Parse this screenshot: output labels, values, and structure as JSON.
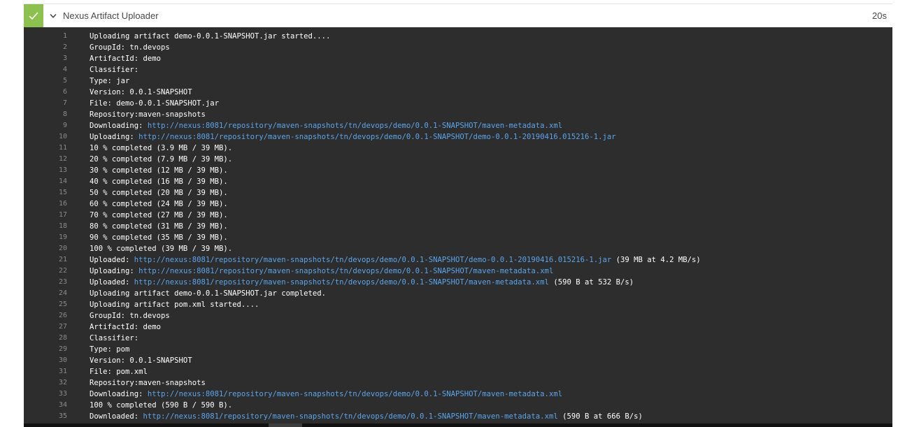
{
  "step": {
    "title": "Nexus Artifact Uploader",
    "duration": "20s",
    "status": "success",
    "status_icon": "checkmark-icon",
    "toggle_icon": "chevron-down-icon"
  },
  "colors": {
    "success": "#8cc04f",
    "log_background": "#2d2d2d",
    "link": "#5aa5ec",
    "line_number": "#8a8a8a",
    "text": "#ffffff"
  },
  "log": {
    "lines": [
      {
        "n": "1",
        "pre": "Uploading artifact demo-0.0.1-SNAPSHOT.jar started....",
        "link": "",
        "post": ""
      },
      {
        "n": "2",
        "pre": "GroupId: tn.devops",
        "link": "",
        "post": ""
      },
      {
        "n": "3",
        "pre": "ArtifactId: demo",
        "link": "",
        "post": ""
      },
      {
        "n": "4",
        "pre": "Classifier:",
        "link": "",
        "post": ""
      },
      {
        "n": "5",
        "pre": "Type: jar",
        "link": "",
        "post": ""
      },
      {
        "n": "6",
        "pre": "Version: 0.0.1-SNAPSHOT",
        "link": "",
        "post": ""
      },
      {
        "n": "7",
        "pre": "File: demo-0.0.1-SNAPSHOT.jar",
        "link": "",
        "post": ""
      },
      {
        "n": "8",
        "pre": "Repository:maven-snapshots",
        "link": "",
        "post": ""
      },
      {
        "n": "9",
        "pre": "Downloading: ",
        "link": "http://nexus:8081/repository/maven-snapshots/tn/devops/demo/0.0.1-SNAPSHOT/maven-metadata.xml",
        "post": ""
      },
      {
        "n": "10",
        "pre": "Uploading: ",
        "link": "http://nexus:8081/repository/maven-snapshots/tn/devops/demo/0.0.1-SNAPSHOT/demo-0.0.1-20190416.015216-1.jar",
        "post": ""
      },
      {
        "n": "11",
        "pre": "10 % completed (3.9 MB / 39 MB).",
        "link": "",
        "post": ""
      },
      {
        "n": "12",
        "pre": "20 % completed (7.9 MB / 39 MB).",
        "link": "",
        "post": ""
      },
      {
        "n": "13",
        "pre": "30 % completed (12 MB / 39 MB).",
        "link": "",
        "post": ""
      },
      {
        "n": "14",
        "pre": "40 % completed (16 MB / 39 MB).",
        "link": "",
        "post": ""
      },
      {
        "n": "15",
        "pre": "50 % completed (20 MB / 39 MB).",
        "link": "",
        "post": ""
      },
      {
        "n": "16",
        "pre": "60 % completed (24 MB / 39 MB).",
        "link": "",
        "post": ""
      },
      {
        "n": "17",
        "pre": "70 % completed (27 MB / 39 MB).",
        "link": "",
        "post": ""
      },
      {
        "n": "18",
        "pre": "80 % completed (31 MB / 39 MB).",
        "link": "",
        "post": ""
      },
      {
        "n": "19",
        "pre": "90 % completed (35 MB / 39 MB).",
        "link": "",
        "post": ""
      },
      {
        "n": "20",
        "pre": "100 % completed (39 MB / 39 MB).",
        "link": "",
        "post": ""
      },
      {
        "n": "21",
        "pre": "Uploaded: ",
        "link": "http://nexus:8081/repository/maven-snapshots/tn/devops/demo/0.0.1-SNAPSHOT/demo-0.0.1-20190416.015216-1.jar",
        "post": " (39 MB at 4.2 MB/s)"
      },
      {
        "n": "22",
        "pre": "Uploading: ",
        "link": "http://nexus:8081/repository/maven-snapshots/tn/devops/demo/0.0.1-SNAPSHOT/maven-metadata.xml",
        "post": ""
      },
      {
        "n": "23",
        "pre": "Uploaded: ",
        "link": "http://nexus:8081/repository/maven-snapshots/tn/devops/demo/0.0.1-SNAPSHOT/maven-metadata.xml",
        "post": " (590 B at 532 B/s)"
      },
      {
        "n": "24",
        "pre": "Uploading artifact demo-0.0.1-SNAPSHOT.jar completed.",
        "link": "",
        "post": ""
      },
      {
        "n": "25",
        "pre": "Uploading artifact pom.xml started....",
        "link": "",
        "post": ""
      },
      {
        "n": "26",
        "pre": "GroupId: tn.devops",
        "link": "",
        "post": ""
      },
      {
        "n": "27",
        "pre": "ArtifactId: demo",
        "link": "",
        "post": ""
      },
      {
        "n": "28",
        "pre": "Classifier:",
        "link": "",
        "post": ""
      },
      {
        "n": "29",
        "pre": "Type: pom",
        "link": "",
        "post": ""
      },
      {
        "n": "30",
        "pre": "Version: 0.0.1-SNAPSHOT",
        "link": "",
        "post": ""
      },
      {
        "n": "31",
        "pre": "File: pom.xml",
        "link": "",
        "post": ""
      },
      {
        "n": "32",
        "pre": "Repository:maven-snapshots",
        "link": "",
        "post": ""
      },
      {
        "n": "33",
        "pre": "Downloading: ",
        "link": "http://nexus:8081/repository/maven-snapshots/tn/devops/demo/0.0.1-SNAPSHOT/maven-metadata.xml",
        "post": ""
      },
      {
        "n": "34",
        "pre": "100 % completed (590 B / 590 B).",
        "link": "",
        "post": ""
      },
      {
        "n": "35",
        "pre": "Downloaded: ",
        "link": "http://nexus:8081/repository/maven-snapshots/tn/devops/demo/0.0.1-SNAPSHOT/maven-metadata.xml",
        "post": " (590 B at 666 B/s)"
      }
    ]
  }
}
